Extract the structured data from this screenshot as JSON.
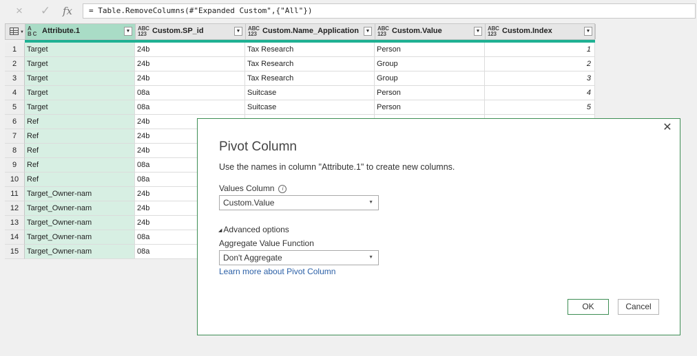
{
  "formula_bar": {
    "cancel_icon": "×",
    "enter_icon": "✓",
    "fx_label": "fx",
    "formula": "= Table.RemoveColumns(#\"Expanded Custom\",{\"All\"})"
  },
  "grid": {
    "columns": [
      {
        "type_top": "A",
        "type_bottom": "B C",
        "label": "Attribute.1"
      },
      {
        "type_top": "ABC",
        "type_bottom": "123",
        "label": "Custom.SP_id"
      },
      {
        "type_top": "ABC",
        "type_bottom": "123",
        "label": "Custom.Name_Application"
      },
      {
        "type_top": "ABC",
        "type_bottom": "123",
        "label": "Custom.Value"
      },
      {
        "type_top": "ABC",
        "type_bottom": "123",
        "label": "Custom.Index"
      }
    ],
    "rows": [
      [
        "1",
        "Target",
        "24b",
        "Tax Research",
        "Person",
        "1"
      ],
      [
        "2",
        "Target",
        "24b",
        "Tax Research",
        "Group",
        "2"
      ],
      [
        "3",
        "Target",
        "24b",
        "Tax Research",
        "Group",
        "3"
      ],
      [
        "4",
        "Target",
        "08a",
        "Suitcase",
        "Person",
        "4"
      ],
      [
        "5",
        "Target",
        "08a",
        "Suitcase",
        "Person",
        "5"
      ],
      [
        "6",
        "Ref",
        "24b",
        "",
        "",
        ""
      ],
      [
        "7",
        "Ref",
        "24b",
        "",
        "",
        ""
      ],
      [
        "8",
        "Ref",
        "24b",
        "",
        "",
        ""
      ],
      [
        "9",
        "Ref",
        "08a",
        "",
        "",
        ""
      ],
      [
        "10",
        "Ref",
        "08a",
        "",
        "",
        ""
      ],
      [
        "11",
        "Target_Owner-nam",
        "24b",
        "",
        "",
        ""
      ],
      [
        "12",
        "Target_Owner-nam",
        "24b",
        "",
        "",
        ""
      ],
      [
        "13",
        "Target_Owner-nam",
        "24b",
        "",
        "",
        ""
      ],
      [
        "14",
        "Target_Owner-nam",
        "08a",
        "",
        "",
        ""
      ],
      [
        "15",
        "Target_Owner-nam",
        "08a",
        "",
        "",
        ""
      ]
    ]
  },
  "dialog": {
    "title": "Pivot Column",
    "description": "Use the names in column \"Attribute.1\" to create new columns.",
    "values_column_label": "Values Column",
    "values_column_value": "Custom.Value",
    "advanced_options_label": "Advanced options",
    "aggregate_label": "Aggregate Value Function",
    "aggregate_value": "Don't Aggregate",
    "learn_more_link": "Learn more about Pivot Column",
    "ok_label": "OK",
    "cancel_label": "Cancel",
    "close_icon": "✕",
    "info_icon": "i"
  }
}
